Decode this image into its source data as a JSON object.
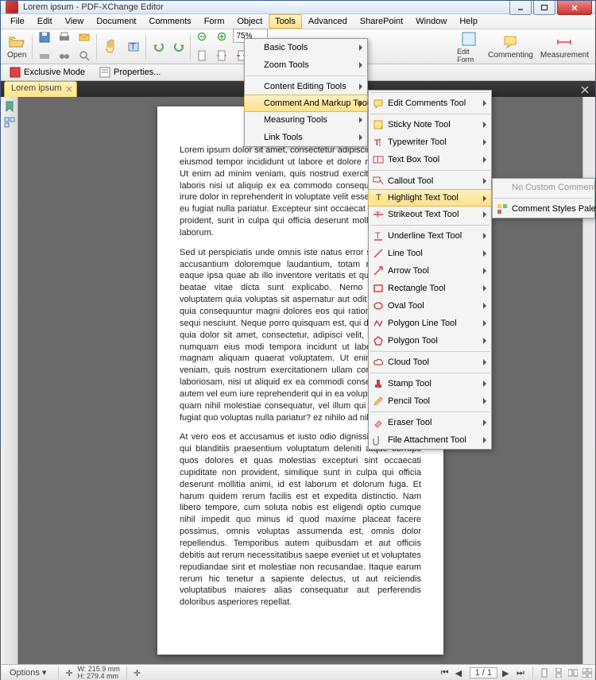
{
  "title": "Lorem ipsum - PDF-XChange Editor",
  "menubar": [
    "File",
    "Edit",
    "View",
    "Document",
    "Comments",
    "Form",
    "Object",
    "Tools",
    "Advanced",
    "SharePoint",
    "Window",
    "Help"
  ],
  "toolbar": {
    "open": "Open",
    "edit": "Edit Form",
    "commenting": "Commenting",
    "measurement": "Measurement",
    "zoom": "75%"
  },
  "secondbar": {
    "exclusive": "Exclusive Mode",
    "properties": "Properties..."
  },
  "tab": "Lorem ipsum",
  "tools_menu": [
    "Basic Tools",
    "Zoom Tools",
    "Content Editing Tools",
    "Comment And Markup Tools",
    "Measuring Tools",
    "Link Tools"
  ],
  "markup_menu": [
    {
      "label": "Edit Comments Tool",
      "icon": "edit-comments"
    },
    {
      "label": "Sticky Note Tool",
      "icon": "sticky"
    },
    {
      "label": "Typewriter Tool",
      "icon": "typewriter"
    },
    {
      "label": "Text Box Tool",
      "icon": "textbox"
    },
    {
      "label": "Callout Tool",
      "icon": "callout"
    },
    {
      "label": "Highlight Text Tool",
      "icon": "highlight",
      "hl": true
    },
    {
      "label": "Strikeout Text Tool",
      "icon": "strike"
    },
    {
      "label": "Underline Text Tool",
      "icon": "underline"
    },
    {
      "label": "Line Tool",
      "icon": "line"
    },
    {
      "label": "Arrow Tool",
      "icon": "arrow"
    },
    {
      "label": "Rectangle Tool",
      "icon": "rect"
    },
    {
      "label": "Oval Tool",
      "icon": "oval"
    },
    {
      "label": "Polygon Line Tool",
      "icon": "polyline"
    },
    {
      "label": "Polygon Tool",
      "icon": "polygon"
    },
    {
      "label": "Cloud Tool",
      "icon": "cloud"
    },
    {
      "label": "Stamp Tool",
      "icon": "stamp"
    },
    {
      "label": "Pencil Tool",
      "icon": "pencil"
    },
    {
      "label": "Eraser Tool",
      "icon": "eraser"
    },
    {
      "label": "File Attachment Tool",
      "icon": "attach"
    }
  ],
  "hl_submenu": [
    "No Custom Comment Style",
    "Comment Styles Palette"
  ],
  "status": {
    "options": "Options",
    "w": "W: 215.9 mm",
    "h": "H: 279.4 mm",
    "page": "1 / 1"
  },
  "doc": {
    "p1": "Lorem ipsum dolor sit amet, consectetur adipiscing elit, sed do eiusmod tempor incididunt ut labore et dolore magna aliqua. Ut enim ad minim veniam, quis nostrud exercitation ullamco laboris nisi ut aliquip ex ea commodo consequat. Duis aute irure dolor in reprehenderit in voluptate velit esse cillum dolore eu fugiat nulla pariatur. Excepteur sint occaecat cupidatat non proident, sunt in culpa qui officia deserunt mollit anim id est laborum.",
    "p2": "Sed ut perspiciatis unde omnis iste natus error sit voluptatem accusantium doloremque laudantium, totam rem aperiam, eaque ipsa quae ab illo inventore veritatis et quasi architecto beatae vitae dicta sunt explicabo. Nemo enim ipsam voluptatem quia voluptas sit aspernatur aut odit aut fugit, sed quia consequuntur magni dolores eos qui ratione voluptatem sequi nesciunt. Neque porro quisquam est, qui dolorem ipsum quia dolor sit amet, consectetur, adipisci velit, sed quia non numquam eius modi tempora incidunt ut labore et dolore magnam aliquam quaerat voluptatem. Ut enim ad minima veniam, quis nostrum exercitationem ullam corporis suscipit laboriosam, nisi ut aliquid ex ea commodi consequatur? Quis autem vel eum iure reprehenderit qui in ea voluptate velit esse quam nihil molestiae consequatur, vel illum qui dolorem eum fugiat quo voluptas nulla pariatur? ez nihilo ad nihilum.",
    "p3": "At vero eos et accusamus et iusto odio dignissimos ducimus qui blanditiis praesentium voluptatum deleniti atque corrupti quos dolores et quas molestias excepturi sint occaecati cupiditate non provident, similique sunt in culpa qui officia deserunt mollitia animi, id est laborum et dolorum fuga. Et harum quidem rerum facilis est et expedita distinctio. Nam libero tempore, cum soluta nobis est eligendi optio cumque nihil impedit quo minus id quod maxime placeat facere possimus, omnis voluptas assumenda est, omnis dolor repellendus. Temporibus autem quibusdam et aut officiis debitis aut rerum necessitatibus saepe eveniet ut et voluptates repudiandae sint et molestiae non recusandae. Itaque earum rerum hic tenetur a sapiente delectus, ut aut reiciendis voluptatibus maiores alias consequatur aut perferendis doloribus asperiores repellat."
  }
}
